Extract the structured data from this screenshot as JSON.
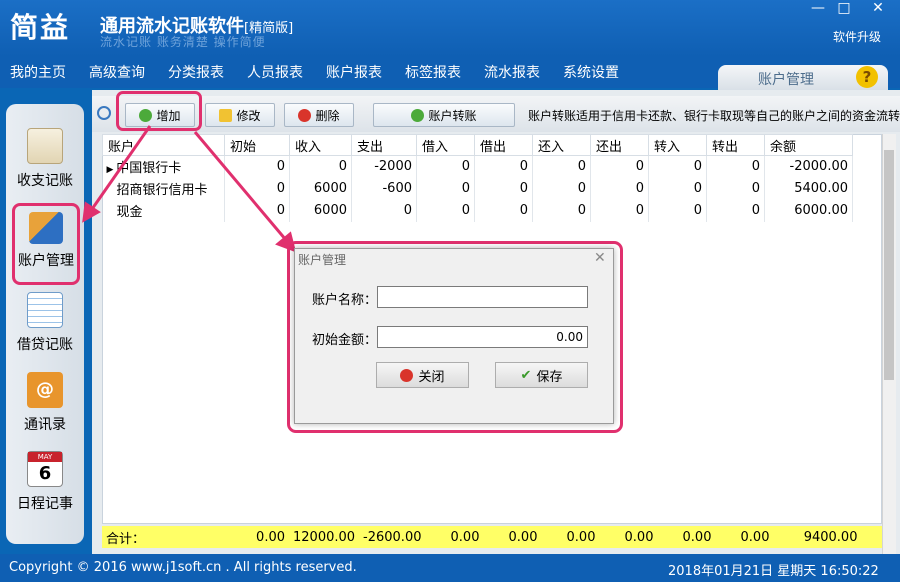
{
  "app": {
    "logo": "简益",
    "title": "通用流水记账软件",
    "edition": "[精简版]",
    "subtitle": "流水记账 账务清楚 操作简便",
    "upgrade": "软件升级"
  },
  "window_controls": {
    "minimize": "—",
    "maximize": "□",
    "close": "✕"
  },
  "menu": [
    "我的主页",
    "高级查询",
    "分类报表",
    "人员报表",
    "账户报表",
    "标签报表",
    "流水报表",
    "系统设置"
  ],
  "right_tab": {
    "label": "账户管理",
    "help": "?"
  },
  "sidebar": [
    "收支记账",
    "账户管理",
    "借贷记账",
    "通讯录",
    "日程记事"
  ],
  "calendar_icon": {
    "month": "MAY",
    "day": "6"
  },
  "toolbar": {
    "add": "增加",
    "edit": "修改",
    "delete": "删除",
    "transfer": "账户转账",
    "note": "账户转账适用于信用卡还款、银行卡取现等自己的账户之间的资金流转操作。"
  },
  "table": {
    "columns": [
      "账户",
      "初始",
      "收入",
      "支出",
      "借入",
      "借出",
      "还入",
      "还出",
      "转入",
      "转出",
      "余额"
    ],
    "rows": [
      [
        "中国银行卡",
        "0",
        "0",
        "-2000",
        "0",
        "0",
        "0",
        "0",
        "0",
        "0",
        "-2000.00"
      ],
      [
        "招商银行信用卡",
        "0",
        "6000",
        "-600",
        "0",
        "0",
        "0",
        "0",
        "0",
        "0",
        "5400.00"
      ],
      [
        "现金",
        "0",
        "6000",
        "0",
        "0",
        "0",
        "0",
        "0",
        "0",
        "0",
        "6000.00"
      ]
    ],
    "total": [
      "合计：",
      "0.00",
      "12000.00",
      "-2600.00",
      "0.00",
      "0.00",
      "0.00",
      "0.00",
      "0.00",
      "0.00",
      "9400.00"
    ]
  },
  "dialog": {
    "title": "账户管理",
    "name_label": "账户名称：",
    "name_value": "",
    "amount_label": "初始金额：",
    "amount_value": "0.00",
    "close": "关闭",
    "save": "保存"
  },
  "status": {
    "copyright": "Copyright © 2016 www.j1soft.cn . All rights reserved.",
    "datetime": "2018年01月21日  星期天  16:50:22"
  },
  "colors": {
    "primary": "#0f5fb3",
    "highlight": "#e0306e",
    "total_row": "#ffff66"
  }
}
